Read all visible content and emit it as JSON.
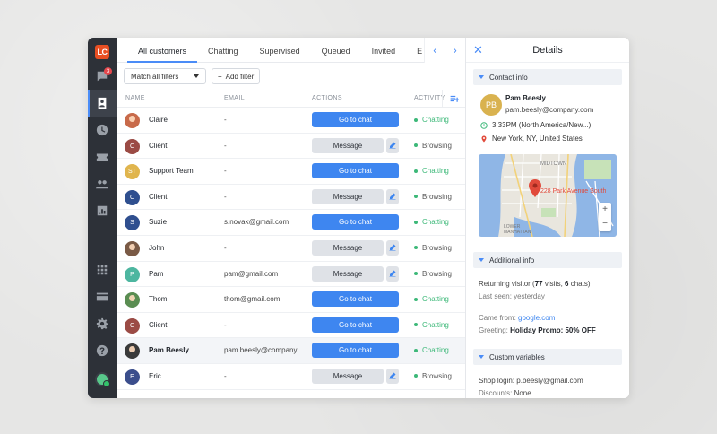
{
  "sidebar": {
    "logo": "LC",
    "chat_badge": "3"
  },
  "tabs": [
    "All customers",
    "Chatting",
    "Supervised",
    "Queued",
    "Invited",
    "E"
  ],
  "filters": {
    "match_label": "Match all filters",
    "add_filter_label": "Add filter"
  },
  "table": {
    "headers": {
      "name": "NAME",
      "email": "EMAIL",
      "actions": "ACTIONS",
      "activity": "ACTIVITY"
    },
    "rows": [
      {
        "name": "Claire",
        "email": "-",
        "action": "Go to chat",
        "status": "Chatting",
        "avatar_color": "#c86a4a",
        "initials": ""
      },
      {
        "name": "Client",
        "email": "-",
        "action": "Message",
        "status": "Browsing",
        "avatar_color": "#9b4b45",
        "initials": "C"
      },
      {
        "name": "Support Team",
        "email": "-",
        "action": "Go to chat",
        "status": "Chatting",
        "avatar_color": "#e0b54e",
        "initials": "ST"
      },
      {
        "name": "Client",
        "email": "-",
        "action": "Message",
        "status": "Browsing",
        "avatar_color": "#2f4f8f",
        "initials": "C"
      },
      {
        "name": "Suzie",
        "email": "s.novak@gmail.com",
        "action": "Go to chat",
        "status": "Chatting",
        "avatar_color": "#2f4f8f",
        "initials": "S"
      },
      {
        "name": "John",
        "email": "-",
        "action": "Message",
        "status": "Browsing",
        "avatar_color": "#7a5a46",
        "initials": ""
      },
      {
        "name": "Pam",
        "email": "pam@gmail.com",
        "action": "Message",
        "status": "Browsing",
        "avatar_color": "#4db6a0",
        "initials": "P"
      },
      {
        "name": "Thom",
        "email": "thom@gmail.com",
        "action": "Go to chat",
        "status": "Chatting",
        "avatar_color": "#5a8d52",
        "initials": ""
      },
      {
        "name": "Client",
        "email": "-",
        "action": "Go to chat",
        "status": "Chatting",
        "avatar_color": "#9b4b45",
        "initials": "C"
      },
      {
        "name": "Pam Beesly",
        "email": "pam.beesly@company....",
        "action": "Go to chat",
        "status": "Chatting",
        "avatar_color": "#3a3a3a",
        "initials": ""
      },
      {
        "name": "Eric",
        "email": "-",
        "action": "Message",
        "status": "Browsing",
        "avatar_color": "#3b4e8c",
        "initials": "E"
      }
    ]
  },
  "details": {
    "title": "Details",
    "contact_info_label": "Contact info",
    "contact": {
      "initials": "PB",
      "name": "Pam Beesly",
      "email": "pam.beesly@company.com",
      "time": "3:33PM (North America/New...)",
      "location": "New York, NY, United States"
    },
    "map": {
      "address": "228 Park Avenue South",
      "area_label_1": "MIDTOWN",
      "area_label_2": "LOWER MANHATTAN",
      "zoom_in": "+",
      "zoom_out": "−"
    },
    "additional_info_label": "Additional info",
    "visits_prefix": "Returning visitor (",
    "visits_bold": "77",
    "visits_mid": " visits, ",
    "chats_bold": "6",
    "visits_suffix": " chats)",
    "last_seen": "Last seen: yesterday",
    "came_from_label": "Came from: ",
    "came_from_value": "google.com",
    "greeting_label": "Greeting: ",
    "greeting_value": "Holiday Promo: 50% OFF",
    "custom_variables_label": "Custom variables",
    "shop_login": "Shop login: p.beesly@gmail.com",
    "discounts_label": "Discounts: ",
    "discounts_value": "None"
  },
  "colors": {
    "accent": "#4a8cf7",
    "sidebar": "#2d3138",
    "chatting": "#3cb878"
  }
}
